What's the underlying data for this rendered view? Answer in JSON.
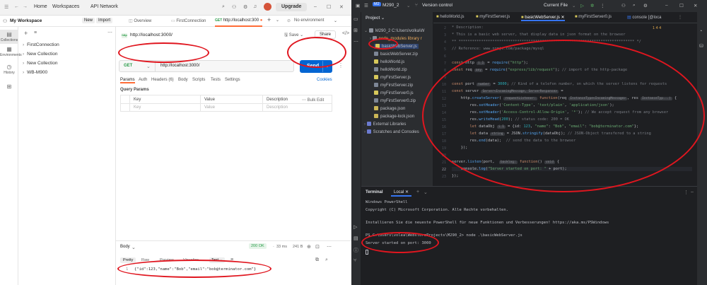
{
  "postman": {
    "titlebar": {
      "home": "Home",
      "workspaces": "Workspaces",
      "api_network": "API Network",
      "upgrade": "Upgrade"
    },
    "workspace": {
      "name": "My Workspace",
      "new": "New",
      "import": "Import"
    },
    "rail": [
      {
        "label": "Collections"
      },
      {
        "label": "Environments"
      },
      {
        "label": "History"
      },
      {
        "label": ""
      }
    ],
    "collections": [
      "FirstConnection",
      "New Collection",
      "New Collection",
      "WB-M900"
    ],
    "tabs": [
      {
        "label": "Overview"
      },
      {
        "label": "FirstConnection"
      },
      {
        "label": "http://localhost:300"
      }
    ],
    "environment": "No environment",
    "request": {
      "title": "http://localhost:3000/",
      "method": "GET",
      "url": "http://localhost:3000/",
      "save": "Save",
      "share": "Share",
      "send": "Send",
      "cookies": "Cookies"
    },
    "subtabs": [
      "Params",
      "Auth",
      "Headers (6)",
      "Body",
      "Scripts",
      "Tests",
      "Settings"
    ],
    "params": {
      "title": "Query Params",
      "headers": [
        "Key",
        "Value",
        "Description"
      ],
      "bulk_edit": "Bulk Edit",
      "row": [
        "Key",
        "Value",
        "Description"
      ]
    },
    "response": {
      "label": "Body",
      "status": "200 OK",
      "time": "33 ms",
      "size": "241 B",
      "tabs": [
        "Pretty",
        "Raw",
        "Preview",
        "Visualize"
      ],
      "format": "Text",
      "line_number": "1",
      "body": "{\"id\":123,\"name\":\"Bob\",\"email\":\"bob@terminator.com\"}"
    }
  },
  "ide": {
    "titlebar": {
      "project_badge": "M2",
      "project": "M290_2",
      "vcs": "Version control",
      "run_config": "Current File"
    },
    "project_label": "Project",
    "tree": [
      {
        "label": "M290_2  C:\\Users\\volka\\W"
      },
      {
        "label": "node_modules  library r"
      },
      {
        "label": "basicWebServer.js"
      },
      {
        "label": "basicWebServer.zip"
      },
      {
        "label": "helloWorld.js"
      },
      {
        "label": "helloWorld.zip"
      },
      {
        "label": "myFirstServer.js"
      },
      {
        "label": "myFirstServer.zip"
      },
      {
        "label": "myFirstServer0.js"
      },
      {
        "label": "myFirstServer0.zip"
      },
      {
        "label": "package.json"
      },
      {
        "label": "package-lock.json"
      },
      {
        "label": "External Libraries"
      },
      {
        "label": "Scratches and Consoles"
      }
    ],
    "tabs": [
      {
        "label": "helloWorld.js"
      },
      {
        "label": "myFirstServer.js"
      },
      {
        "label": "basicWebServer.js"
      },
      {
        "label": "myFirstServer0.js"
      },
      {
        "label": "console [@loca"
      }
    ],
    "inspections": "1  4  4",
    "terminal": {
      "tab": "Terminal",
      "local": "Local",
      "lines": [
        "Windows PowerShell",
        "Copyright (C) Microsoft Corporation. Alle Rechte vorbehalten.",
        "Installieren Sie die neueste PowerShell für neue Funktionen und Verbesserungen! https://aka.ms/PSWindows",
        "PS C:\\Users\\volea\\WebstormProjects\\M290_2> node .\\basicWebServer.js",
        "Server started on port: 3000"
      ]
    }
  }
}
